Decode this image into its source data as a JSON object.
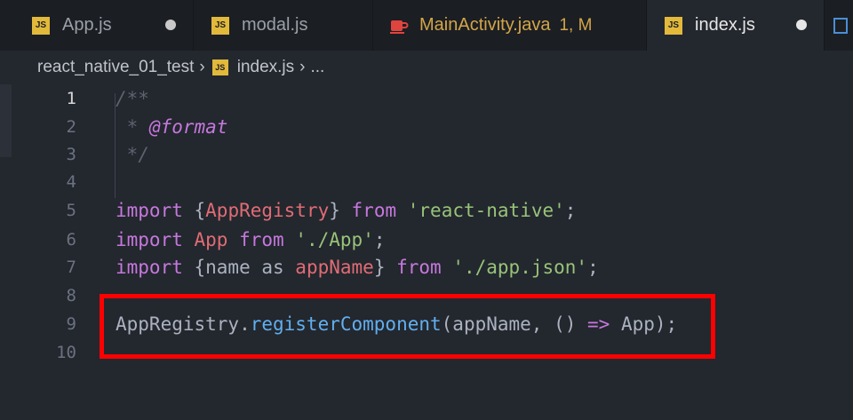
{
  "tabs": [
    {
      "label": "App.js",
      "icon": "js-icon",
      "dirty": true
    },
    {
      "label": "modal.js",
      "icon": "js-icon",
      "dirty": false
    },
    {
      "label": "MainActivity.java",
      "icon": "java-icon",
      "status": "1, M"
    },
    {
      "label": "index.js",
      "icon": "js-icon",
      "dirty": true,
      "active": true
    }
  ],
  "icons": {
    "js_badge": "JS"
  },
  "breadcrumb": {
    "folder": "react_native_01_test",
    "file": "index.js",
    "more": "..."
  },
  "code_lines": [
    {
      "num": "1",
      "tokens": [
        {
          "t": "/**",
          "c": "comment"
        }
      ]
    },
    {
      "num": "2",
      "tokens": [
        {
          "t": " * ",
          "c": "comment"
        },
        {
          "t": "@format",
          "c": "tag"
        }
      ]
    },
    {
      "num": "3",
      "tokens": [
        {
          "t": " */",
          "c": "comment"
        }
      ]
    },
    {
      "num": "4",
      "tokens": []
    },
    {
      "num": "5",
      "tokens": [
        {
          "t": "import",
          "c": "kw"
        },
        {
          "t": " {",
          "c": "plain"
        },
        {
          "t": "AppRegistry",
          "c": "name"
        },
        {
          "t": "} ",
          "c": "plain"
        },
        {
          "t": "from",
          "c": "kw"
        },
        {
          "t": " ",
          "c": "plain"
        },
        {
          "t": "'react-native'",
          "c": "str"
        },
        {
          "t": ";",
          "c": "plain"
        }
      ]
    },
    {
      "num": "6",
      "tokens": [
        {
          "t": "import",
          "c": "kw"
        },
        {
          "t": " ",
          "c": "plain"
        },
        {
          "t": "App",
          "c": "name"
        },
        {
          "t": " ",
          "c": "plain"
        },
        {
          "t": "from",
          "c": "kw"
        },
        {
          "t": " ",
          "c": "plain"
        },
        {
          "t": "'./App'",
          "c": "str"
        },
        {
          "t": ";",
          "c": "plain"
        }
      ]
    },
    {
      "num": "7",
      "tokens": [
        {
          "t": "import",
          "c": "kw"
        },
        {
          "t": " {name as ",
          "c": "plain"
        },
        {
          "t": "appName",
          "c": "name"
        },
        {
          "t": "} ",
          "c": "plain"
        },
        {
          "t": "from",
          "c": "kw"
        },
        {
          "t": " ",
          "c": "plain"
        },
        {
          "t": "'./app.json'",
          "c": "str"
        },
        {
          "t": ";",
          "c": "plain"
        }
      ]
    },
    {
      "num": "8",
      "tokens": []
    },
    {
      "num": "9",
      "tokens": [
        {
          "t": "AppRegistry.",
          "c": "plain"
        },
        {
          "t": "registerComponent",
          "c": "fn"
        },
        {
          "t": "(appName, () ",
          "c": "plain"
        },
        {
          "t": "=>",
          "c": "op"
        },
        {
          "t": " App);",
          "c": "plain"
        }
      ]
    },
    {
      "num": "10",
      "tokens": []
    }
  ],
  "current_line": "1"
}
